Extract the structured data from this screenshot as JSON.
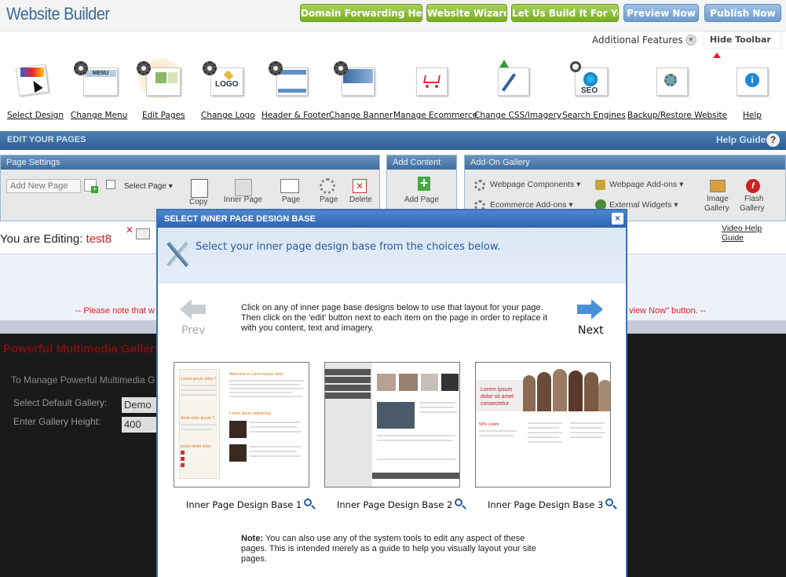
{
  "app": {
    "title": "Website Builder"
  },
  "top_buttons": [
    {
      "label": "Domain Forwarding Help ?",
      "color": "green"
    },
    {
      "label": "Website Wizard",
      "color": "green"
    },
    {
      "label": "Let Us Build It For You",
      "color": "green"
    },
    {
      "label": "Preview Now",
      "color": "blue"
    },
    {
      "label": "Publish Now",
      "color": "blue"
    }
  ],
  "additional_features": "Additional Features",
  "hide_toolbar": "Hide Toolbar",
  "toolbar": [
    {
      "label": "Select Design",
      "icon": "select-design-icon"
    },
    {
      "label": "Change Menu",
      "icon": "menu-icon"
    },
    {
      "label": "Edit Pages",
      "icon": "edit-pages-icon"
    },
    {
      "label": "Change Logo",
      "icon": "logo-icon"
    },
    {
      "label": "Header & Footer",
      "icon": "header-footer-icon"
    },
    {
      "label": "Change Banner",
      "icon": "banner-icon"
    },
    {
      "label": "Manage Ecommerce",
      "icon": "cart-icon"
    },
    {
      "label": "Change CSS/Imagery",
      "icon": "css-imagery-icon"
    },
    {
      "label": "Search Engines",
      "icon": "seo-icon"
    },
    {
      "label": "Backup/Restore Website",
      "icon": "backup-icon"
    },
    {
      "label": "Help",
      "icon": "help-icon"
    }
  ],
  "edit_bar": {
    "title": "EDIT YOUR PAGES",
    "help_guide": "Help Guide",
    "help_q": "?"
  },
  "page_settings": {
    "title": "Page Settings",
    "add_page_placeholder": "Add New Page",
    "select_page": "Select Page",
    "copy": "Copy",
    "inner_page": "Inner Page",
    "page": "Page",
    "page2": "Page",
    "delete": "Delete"
  },
  "add_content": {
    "title": "Add Content",
    "add_page": "Add Page"
  },
  "addon_gallery": {
    "title": "Add-On Gallery",
    "webpage_components": "Webpage Components",
    "webpage_addons": "Webpage Add-ons",
    "ecommerce_addons": "Ecommerce Add-ons",
    "external_widgets": "External Widgets",
    "image_gallery_1": "Image",
    "image_gallery_2": "Gallery",
    "flash_gallery_1": "Flash",
    "flash_gallery_2": "Gallery"
  },
  "editing": {
    "prefix": "You are Editing:",
    "page": "test8"
  },
  "video_help": "Video Help Guide",
  "notice": {
    "left": "-- Please note that w",
    "right": "view Now\" button. --"
  },
  "background": {
    "title": "Powerful Multimedia Galler",
    "manage": "To Manage Powerful Multimedia G",
    "default_gallery_label": "Select Default Gallery:",
    "default_gallery_value": "Demo",
    "height_label": "Enter Gallery Height:",
    "height_value": "400"
  },
  "modal": {
    "title": "SELECT INNER PAGE DESIGN BASE",
    "close": "×",
    "subtitle": "Select your inner page design base from the choices below.",
    "instructions": "Click on any of inner page base designs below to use that layout for your page. Then click on the 'edit' button next to each item on the page in order to replace it with you content, text and imagery.",
    "prev": "Prev",
    "next": "Next",
    "designs": [
      {
        "caption": "Inner Page Design Base 1"
      },
      {
        "caption": "Inner Page Design Base 2"
      },
      {
        "caption": "Inner Page Design Base 3"
      }
    ],
    "thumb1": {
      "welcome": "Welcome to Lorem ipsum dolor",
      "q1": "Lorem ipsum dolor ?",
      "q2": "Lorem ipsum adipiscing",
      "q3": "Amet dolor ipsum ?",
      "q4": "Ipsum Amet dolor"
    },
    "thumb3": {
      "banner": "Lorem ipsum dolor sit amet consectetur",
      "sub": "50% Lorem"
    },
    "note_label": "Note:",
    "note_text": " You can also use any of the system tools to edit any aspect of these pages. This is intended merely as a guide to help you visually layout your site pages."
  },
  "colors": {
    "accent_blue": "#2e64b0",
    "green_button": "#8bbf35",
    "warning_red": "#dd2222"
  }
}
